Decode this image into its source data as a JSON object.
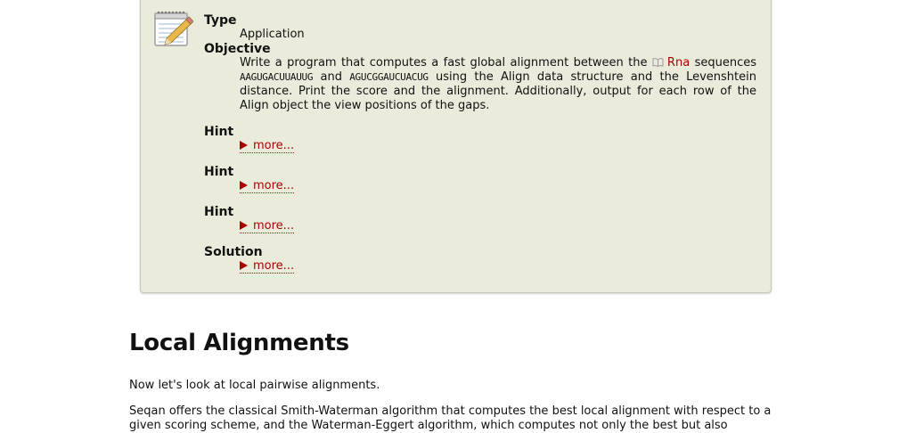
{
  "assignment": {
    "icon": "notepad-pencil-icon",
    "type_label": "Type",
    "type_value": "Application",
    "objective_label": "Objective",
    "objective": {
      "text1": "Write a program that computes a fast global alignment between the",
      "link_icon": "book-icon",
      "link_text": "Rna",
      "text2": "sequences",
      "seq1": "AAGUGACUUAUUG",
      "text3": "and",
      "seq2": "AGUCGGAUCUACUG",
      "text4": "using the Align data structure and the Levenshtein distance. Print the score and the alignment. Additionally, output for each row of the Align object the view positions of the gaps."
    },
    "sections": [
      {
        "label": "Hint",
        "more": "more..."
      },
      {
        "label": "Hint",
        "more": "more..."
      },
      {
        "label": "Hint",
        "more": "more..."
      },
      {
        "label": "Solution",
        "more": "more..."
      }
    ]
  },
  "content": {
    "heading": "Local Alignments",
    "para1": "Now let's look at local pairwise alignments.",
    "para2": "Seqan offers the classical Smith-Waterman algorithm that computes the best local alignment with respect to a given scoring scheme, and the Waterman-Eggert algorithm, which computes not only the best but also"
  },
  "colors": {
    "link": "#aa0000",
    "box_bg": "#ebebdb",
    "box_border": "#c9c9b4"
  }
}
